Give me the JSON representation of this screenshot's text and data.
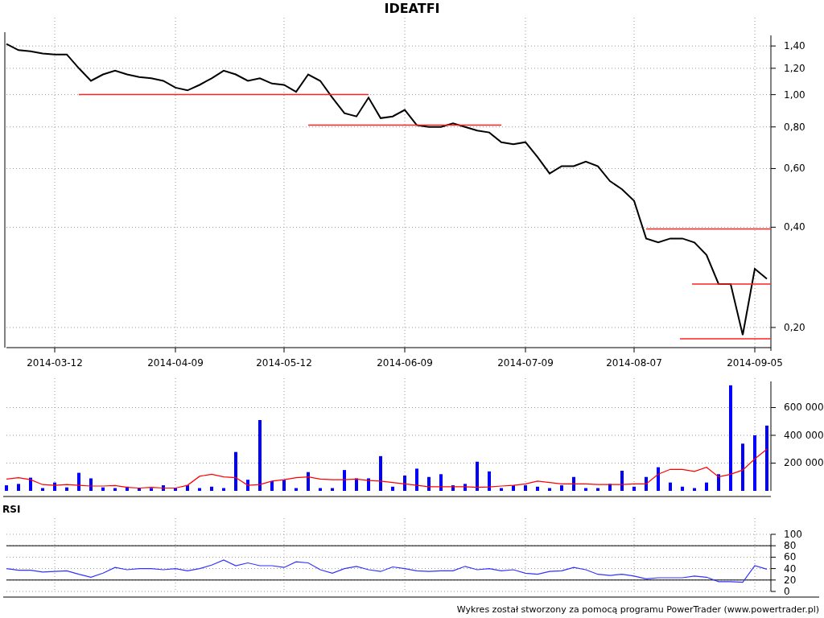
{
  "title": "IDEATFI",
  "price_chart": {
    "chart_data": {
      "type": "line",
      "log": true,
      "grid": true,
      "categories": [
        null,
        null,
        null,
        null,
        "2014-03-12",
        null,
        null,
        null,
        null,
        null,
        null,
        null,
        null,
        null,
        "2014-04-09",
        null,
        null,
        null,
        null,
        null,
        null,
        null,
        null,
        "2014-05-12",
        null,
        null,
        null,
        null,
        null,
        null,
        null,
        null,
        null,
        "2014-06-09",
        null,
        null,
        null,
        null,
        null,
        null,
        null,
        null,
        null,
        "2014-07-09",
        null,
        null,
        null,
        null,
        null,
        null,
        null,
        null,
        "2014-08-07",
        null,
        null,
        null,
        null,
        null,
        null,
        null,
        null,
        null,
        "2014-09-05",
        null
      ],
      "series": [
        {
          "color": "#000000",
          "values": [
            1.42,
            1.36,
            1.35,
            1.33,
            1.32,
            1.32,
            1.2,
            1.1,
            1.15,
            1.18,
            1.15,
            1.13,
            1.12,
            1.1,
            1.05,
            1.03,
            1.07,
            1.12,
            1.18,
            1.15,
            1.1,
            1.12,
            1.08,
            1.07,
            1.02,
            1.15,
            1.1,
            0.98,
            0.88,
            0.86,
            0.98,
            0.85,
            0.86,
            0.9,
            0.81,
            0.8,
            0.8,
            0.82,
            0.8,
            0.78,
            0.77,
            0.72,
            0.71,
            0.72,
            0.65,
            0.58,
            0.61,
            0.61,
            0.63,
            0.61,
            0.55,
            0.52,
            0.48,
            0.37,
            0.36,
            0.37,
            0.37,
            0.36,
            0.33,
            0.27,
            0.27,
            0.19,
            0.3,
            0.28
          ]
        }
      ],
      "ylim": [
        0.174,
        1.54
      ],
      "yticks": [
        {
          "value": 0.2,
          "label": "0,20"
        },
        {
          "value": 0.4,
          "label": "0,40"
        },
        {
          "value": 0.6,
          "label": "0,60"
        },
        {
          "value": 0.8,
          "label": "0,80"
        },
        {
          "value": 1.0,
          "label": "1,00"
        },
        {
          "value": 1.2,
          "label": "1,20"
        },
        {
          "value": 1.4,
          "label": "1,40"
        }
      ]
    }
  },
  "volume_chart": {
    "chart_data": {
      "type": "bar",
      "grid": true,
      "series": [
        {
          "type": "bar",
          "color": "#0000ff",
          "values": [
            40000,
            50000,
            95000,
            20000,
            60000,
            25000,
            130000,
            90000,
            25000,
            20000,
            30000,
            20000,
            20000,
            40000,
            20000,
            40000,
            20000,
            30000,
            20000,
            280000,
            80000,
            510000,
            70000,
            80000,
            20000,
            135000,
            20000,
            20000,
            150000,
            90000,
            90000,
            250000,
            30000,
            110000,
            160000,
            100000,
            120000,
            40000,
            50000,
            210000,
            140000,
            20000,
            40000,
            40000,
            30000,
            20000,
            40000,
            100000,
            20000,
            20000,
            50000,
            145000,
            30000,
            100000,
            170000,
            60000,
            30000,
            20000,
            60000,
            120000,
            760000,
            340000,
            400000,
            470000
          ]
        },
        {
          "type": "line",
          "color": "#ff0000",
          "values": [
            85000,
            95000,
            80000,
            45000,
            40000,
            45000,
            40000,
            35000,
            35000,
            38000,
            25000,
            20000,
            25000,
            20000,
            20000,
            40000,
            105000,
            120000,
            100000,
            95000,
            40000,
            45000,
            70000,
            80000,
            95000,
            100000,
            85000,
            80000,
            80000,
            85000,
            75000,
            70000,
            60000,
            50000,
            40000,
            30000,
            30000,
            30000,
            30000,
            25000,
            28000,
            35000,
            40000,
            50000,
            70000,
            60000,
            50000,
            50000,
            50000,
            45000,
            45000,
            45000,
            50000,
            50000,
            120000,
            155000,
            155000,
            140000,
            170000,
            100000,
            120000,
            150000,
            230000,
            300000
          ]
        }
      ],
      "ylim": [
        0,
        765000
      ],
      "yticks": [
        {
          "value": 200000,
          "label": "200 000"
        },
        {
          "value": 400000,
          "label": "400 000"
        },
        {
          "value": 600000,
          "label": "600 000"
        }
      ]
    }
  },
  "rsi_panel": {
    "chart_data": {
      "type": "line",
      "grid": true,
      "series": [
        {
          "name": "RSI",
          "color": "#3333ff",
          "values": [
            40,
            37,
            37,
            34,
            35,
            36,
            30,
            25,
            32,
            42,
            38,
            40,
            40,
            38,
            40,
            36,
            40,
            46,
            55,
            45,
            50,
            45,
            45,
            42,
            52,
            50,
            38,
            32,
            40,
            44,
            38,
            35,
            43,
            40,
            36,
            35,
            36,
            36,
            44,
            38,
            40,
            36,
            38,
            32,
            30,
            35,
            36,
            42,
            38,
            30,
            28,
            30,
            27,
            22,
            24,
            24,
            24,
            27,
            25,
            17,
            17,
            16,
            45,
            39
          ]
        }
      ],
      "ylim": [
        0,
        100
      ],
      "yticks": [
        0,
        20,
        40,
        60,
        80,
        100
      ]
    }
  },
  "footer": "Wykres został stworzony za pomocą programu PowerTrader (www.powertrader.pl)"
}
